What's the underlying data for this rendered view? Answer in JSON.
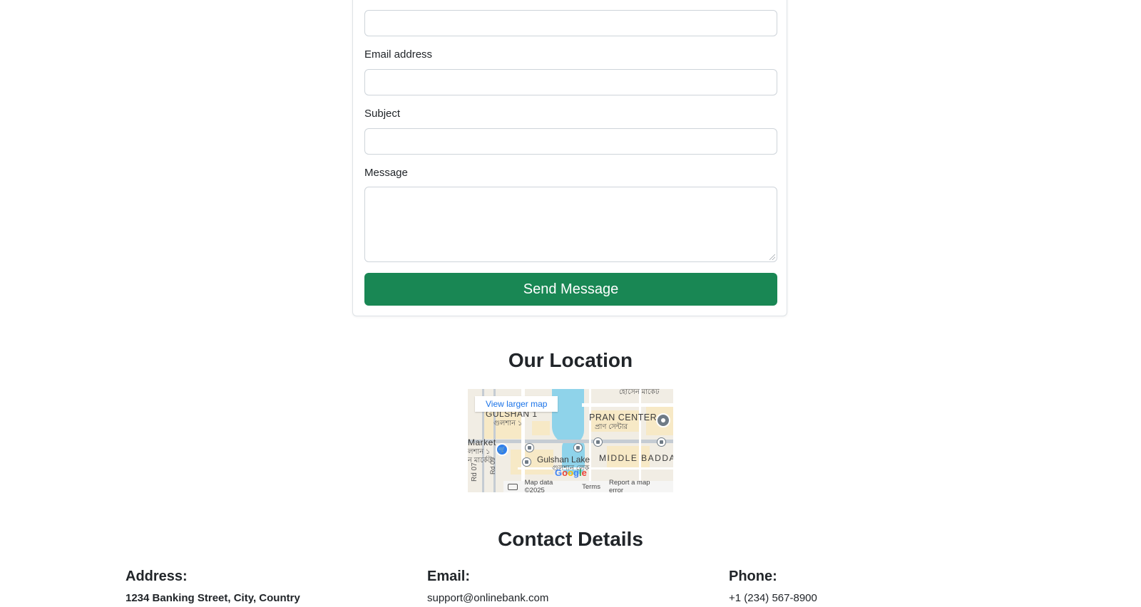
{
  "form": {
    "email_label": "Email address",
    "subject_label": "Subject",
    "message_label": "Message",
    "send_label": "Send Message",
    "send_color": "#198754"
  },
  "location": {
    "title": "Our Location",
    "map": {
      "view_larger": "View larger map",
      "labels": {
        "gulshan1": "GULSHAN 1",
        "gulshan1_bn": "গুলশান ১",
        "pran_center": "PRAN CENTER",
        "pran_center_bn": "প্রাণ সেন্টার",
        "market": "Market",
        "market_bn1": "লশান ১",
        "market_bn2": "ন মার্কেট",
        "gulshan_lake": "Gulshan Lake",
        "gulshan_lake_bn": "গুলশান লেক",
        "middle_badda": "MIDDLE BADDA",
        "top_bn": "হোসেন মার্কেট",
        "road1": "Rd 07",
        "road2": "Rd 09"
      },
      "footer": {
        "map_data": "Map data ©2025",
        "terms": "Terms",
        "report": "Report a map error"
      },
      "google": [
        "G",
        "o",
        "o",
        "g",
        "l",
        "e"
      ]
    }
  },
  "contact": {
    "title": "Contact Details",
    "address_heading": "Address:",
    "address_value": "1234 Banking Street, City, Country",
    "email_heading": "Email:",
    "email_value": "support@onlinebank.com",
    "phone_heading": "Phone:",
    "phone_value": "+1 (234) 567-8900"
  }
}
